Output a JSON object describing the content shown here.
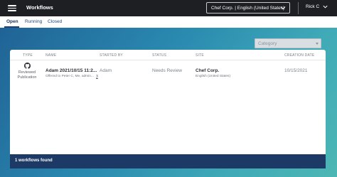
{
  "header": {
    "app_title": "Workflows",
    "site_selector": "Chef Corp. | English (United States)",
    "user": "Rick C"
  },
  "tabs": [
    {
      "label": "Open",
      "active": true
    },
    {
      "label": "Running",
      "active": false
    },
    {
      "label": "Closed",
      "active": false
    }
  ],
  "filter": {
    "category_placeholder": "Category"
  },
  "table": {
    "columns": [
      "TYPE",
      "NAME",
      "STARTED BY",
      "STATUS",
      "SITE",
      "CREATION DATE"
    ],
    "rows": [
      {
        "type_icon": "github-icon",
        "type_label": "Reviewed Publication",
        "name": "Adam 2021/10/15 11:2...",
        "name_sub": "Offered to Peter C, Me, admin...",
        "started_by": "Adam",
        "started_by_extra": "3",
        "status": "Needs Review",
        "site": "Chef Corp.",
        "site_sub": "English (United States)",
        "creation_date": "10/15/2021"
      }
    ]
  },
  "footer": {
    "count_text": "1 workflows found"
  },
  "colors": {
    "topbar": "#1d1f22",
    "footer": "#1d3a66",
    "accent": "#1e3f78"
  }
}
